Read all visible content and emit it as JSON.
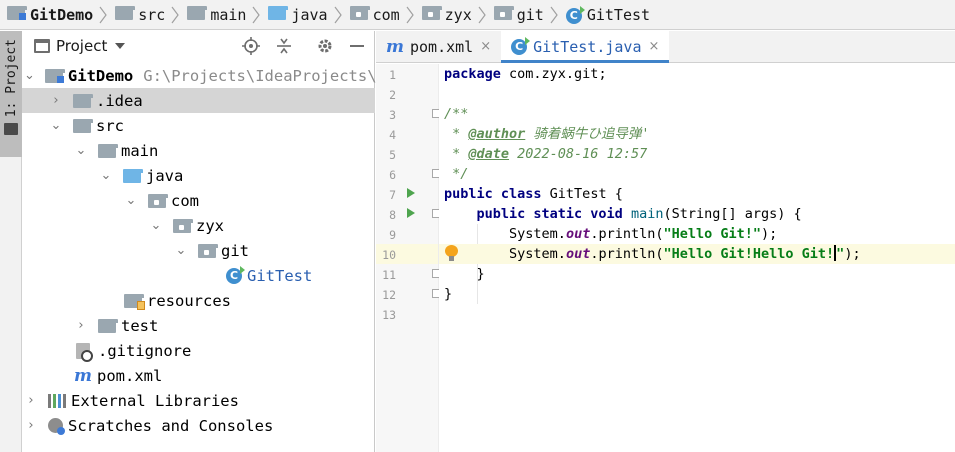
{
  "breadcrumb": {
    "items": [
      "GitDemo",
      "src",
      "main",
      "java",
      "com",
      "zyx",
      "git",
      "GitTest"
    ]
  },
  "stripe": {
    "label": "1: Project"
  },
  "project_panel": {
    "title": "Project",
    "tree": [
      {
        "label": "GitDemo",
        "path": "G:\\Projects\\IdeaProjects\\G"
      },
      {
        "label": ".idea"
      },
      {
        "label": "src"
      },
      {
        "label": "main"
      },
      {
        "label": "java"
      },
      {
        "label": "com"
      },
      {
        "label": "zyx"
      },
      {
        "label": "git"
      },
      {
        "label": "GitTest"
      },
      {
        "label": "resources"
      },
      {
        "label": "test"
      },
      {
        "label": ".gitignore"
      },
      {
        "label": "pom.xml"
      },
      {
        "label": "External Libraries"
      },
      {
        "label": "Scratches and Consoles"
      }
    ],
    "pom_icon_letter": "m"
  },
  "editor": {
    "tabs": [
      {
        "label": "pom.xml",
        "icon": "m",
        "close": "×"
      },
      {
        "label": "GitTest.java",
        "icon": "C",
        "close": "×"
      }
    ],
    "line_numbers": [
      "1",
      "2",
      "3",
      "4",
      "5",
      "6",
      "7",
      "8",
      "9",
      "10",
      "11",
      "12",
      "13"
    ],
    "code": {
      "l1_kw": "package",
      "l1_rest": " com.zyx.git;",
      "l3": "/**",
      "l4_pre": " * ",
      "l4_tag": "@author",
      "l4_text": " 骑着蜗牛ひ追导弹'",
      "l5_pre": " * ",
      "l5_tag": "@date",
      "l5_text": " 2022-08-16 12:57",
      "l6": " */",
      "l7_kw": "public class",
      "l7_rest": " GitTest {",
      "l8_indent": "    ",
      "l8_kw": "public static void",
      "l8_sp": " ",
      "l8_fn": "main",
      "l8_rest": "(String[] args) {",
      "l9_indent": "        ",
      "l9_sys": "System.",
      "l9_out": "out",
      "l9_mid": ".println(",
      "l9_str": "\"Hello Git!\"",
      "l9_end": ");",
      "l10_indent": "        ",
      "l10_sys": "System.",
      "l10_out": "out",
      "l10_mid": ".println(",
      "l10_str": "\"Hello Git!Hello Git!",
      "l10_str2": "\"",
      "l10_end": ");",
      "l11": "    }",
      "l12": "}"
    }
  },
  "colors": {
    "keyword": "#000080",
    "string": "#067d17",
    "doc": "#5f8f55",
    "field": "#660e7a",
    "accent": "#4083c9",
    "selection": "#d5d5d5",
    "current_line": "#fcfae0"
  }
}
